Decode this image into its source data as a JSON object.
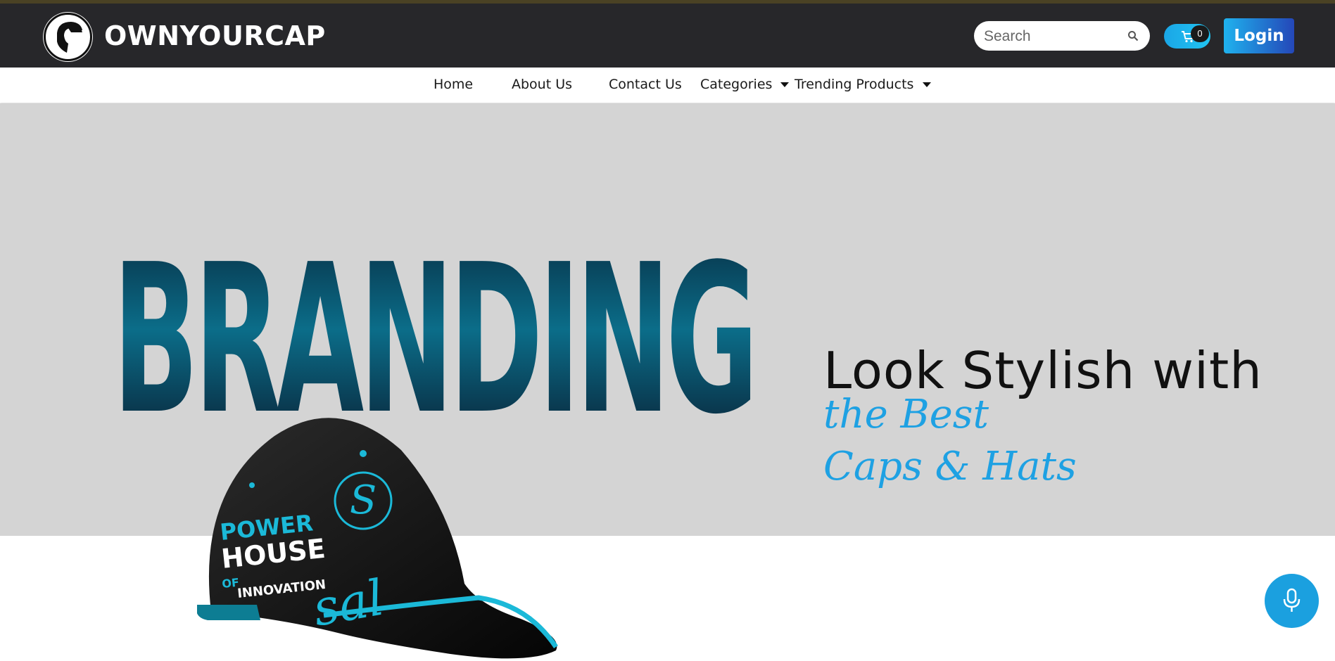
{
  "header": {
    "brand": "OWNYOURCAP",
    "search_placeholder": "Search",
    "cart_count": "0",
    "login_label": "Login"
  },
  "nav": {
    "items": [
      {
        "label": "Home",
        "icon": null
      },
      {
        "label": "About Us",
        "icon": null
      },
      {
        "label": "Contact Us",
        "icon": null
      },
      {
        "label": "Categories",
        "icon": "caret-down-icon"
      },
      {
        "label": "Trending Products",
        "icon": "caret-down-icon"
      }
    ]
  },
  "hero": {
    "image_text": "BRANDING",
    "headline": "Look Stylish with",
    "script_line_1": "the Best",
    "script_line_2": "Caps & Hats",
    "cap_text": {
      "line1": "POWER",
      "line2": "HOUSE",
      "line3": "OF",
      "line4": "INNOVATION",
      "signature": "sal"
    }
  },
  "colors": {
    "header_bg": "#27272a",
    "hero_bg": "#d4d4d4",
    "accent": "#1ea1e3",
    "login_gradient_start": "#1fb2ee",
    "login_gradient_end": "#2447b8"
  },
  "icons": [
    "logo-icon",
    "search-icon",
    "cart-icon",
    "microphone-icon"
  ]
}
